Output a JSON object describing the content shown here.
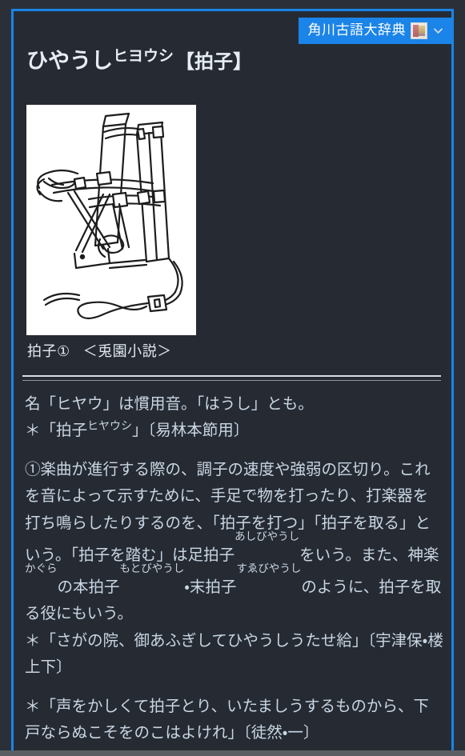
{
  "colors": {
    "page_background": "#2b3038",
    "card_background": "#262b33",
    "accent_blue": "#1b84e8",
    "body_text": "#c9d6e4",
    "headword_text": "#e7edf4",
    "badge_text": "#ffffff",
    "divider": "#d9dde2",
    "bottom_strip": "#5b5f63"
  },
  "badge": {
    "label": "角川古語大辞典",
    "thumbnail_name": "dictionary-cover-thumbnail",
    "chevron_icon": "chevron-down-icon"
  },
  "headword": {
    "kana": "ひやうし",
    "reading_superscript": "ヒヨウシ",
    "kanji": "【拍子】"
  },
  "illustration": {
    "alt_name": "hyoushi-clapper-line-drawing",
    "caption_term": "拍子①",
    "caption_source": "＜兎園小説＞"
  },
  "body": {
    "note_line_1": "名「ヒヤウ」は慣用音。「はうし」とも。",
    "citation_1": {
      "prefix": "＊「拍子",
      "ruby": "ヒヤウシ",
      "suffix": "」〔易林本節用〕"
    },
    "definition_1": {
      "marker": "①",
      "text_part_1": "楽曲が進行する際の、調子の速度や強弱の区切り。これを音によって示すために、手足で物を打ったり、打楽器を打ち鳴らしたりするのを、「拍子を打つ」「拍子を取る」という。「拍子を踏む」は足拍子",
      "ruby_1": "あしびやうし",
      "text_part_2": "をいう。また、神楽",
      "ruby_2": "かぐら",
      "text_part_3": "の本拍子",
      "ruby_3": "もとびやうし",
      "text_part_4": "・末拍子",
      "ruby_4": "すゑびやうし",
      "text_part_5": "のように、拍子を取る役にもいう。"
    },
    "citation_2": "＊「さがの院、御あふぎしてひやうしうたせ給」〔宇津保・楼上下〕",
    "citation_3": "＊「声をかしくて拍子とり、いたましうするものから、下戸ならぬこそをのこはよけれ」〔徒然・一〕"
  }
}
